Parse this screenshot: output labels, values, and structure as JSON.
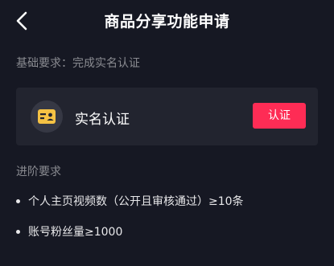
{
  "header": {
    "title": "商品分享功能申请",
    "back_icon": "chevron-left-icon"
  },
  "basic": {
    "label": "基础要求：完成实名认证",
    "card": {
      "icon": "id-card-icon",
      "icon_color": "#f5c244",
      "title": "实名认证",
      "button_label": "认证",
      "button_color": "#fe2c55"
    }
  },
  "advanced": {
    "label": "进阶要求",
    "items": [
      "个人主页视频数（公开且审核通过）≥10条",
      "账号粉丝量≥1000"
    ]
  },
  "colors": {
    "background": "#161823",
    "card": "#22242f",
    "muted_text": "#8a8b91"
  }
}
